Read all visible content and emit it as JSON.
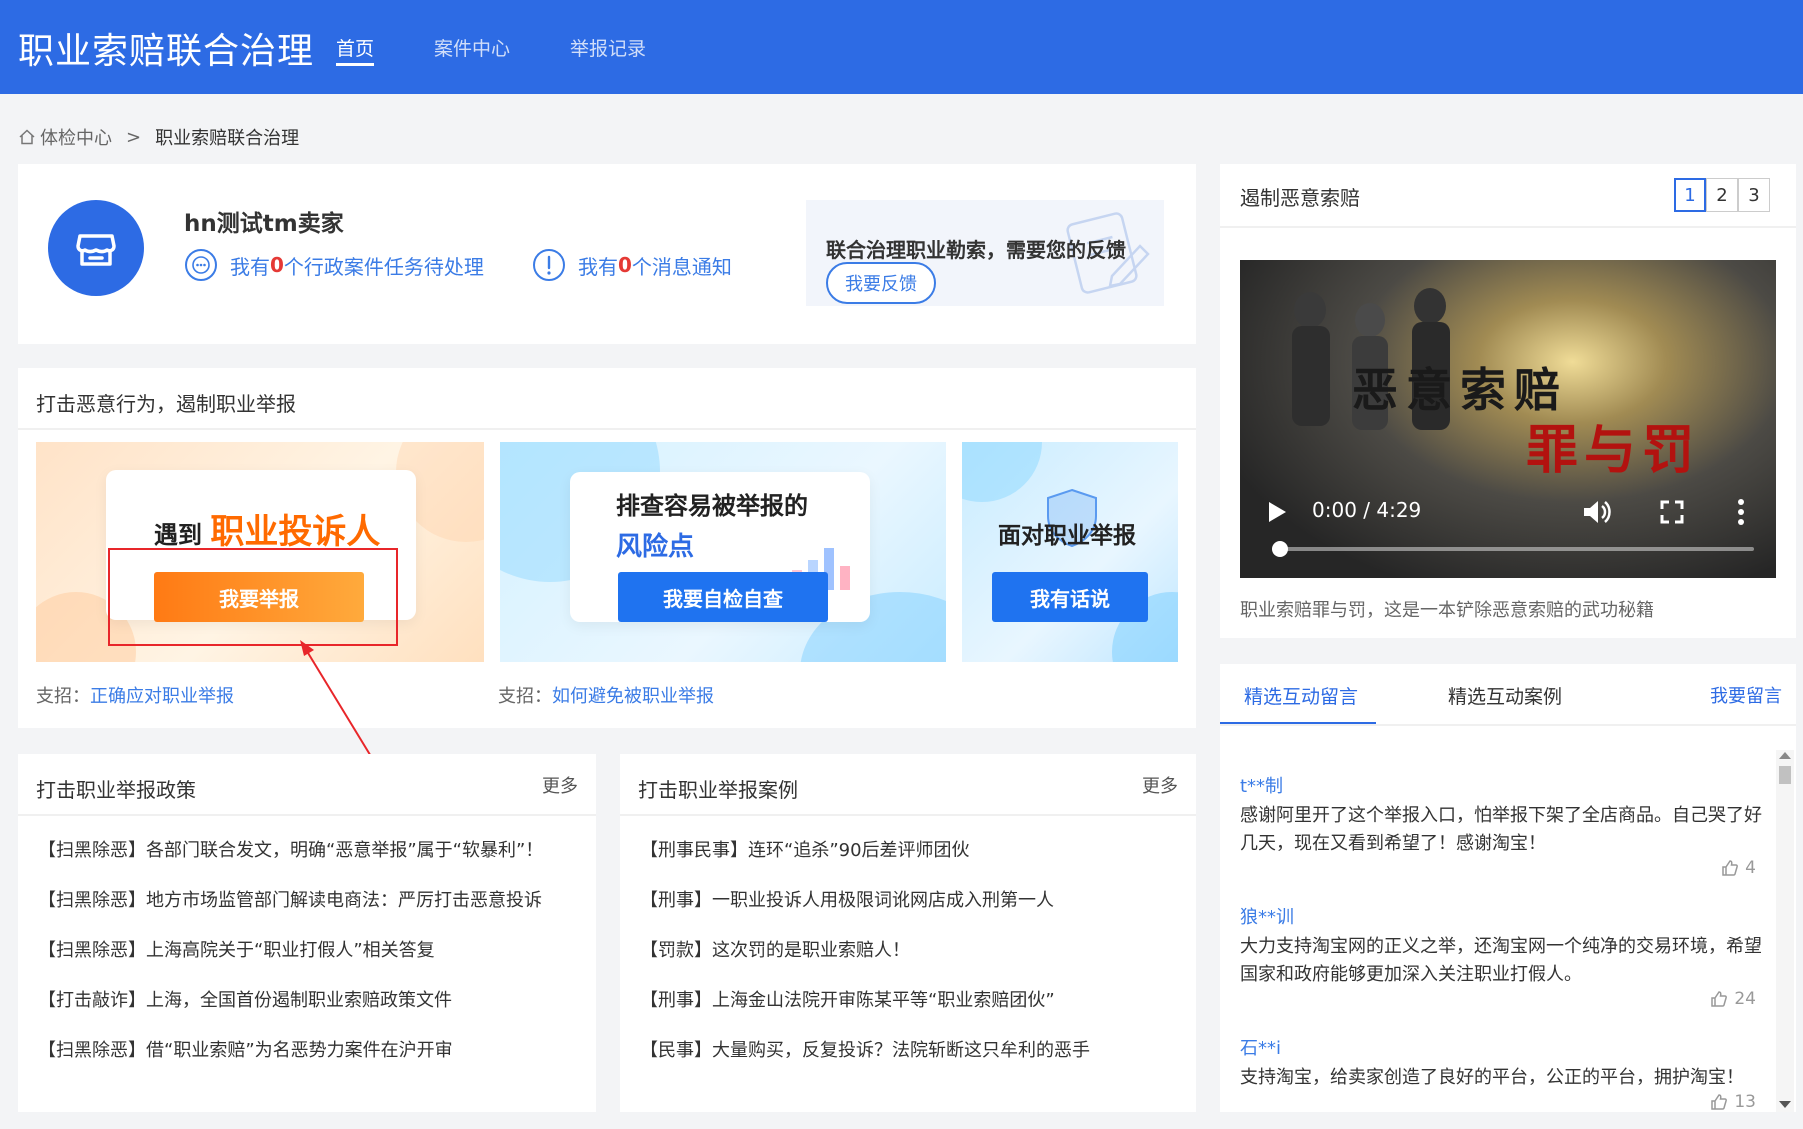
{
  "header": {
    "brand": "职业索赔联合治理",
    "nav": [
      {
        "label": "首页",
        "active": true
      },
      {
        "label": "案件中心",
        "active": false
      },
      {
        "label": "举报记录",
        "active": false
      }
    ],
    "bg_color": "#2d6be4"
  },
  "breadcrumb": {
    "home": "体检中心",
    "separator": ">",
    "current": "职业索赔联合治理",
    "home_icon": "home-icon"
  },
  "user": {
    "name": "hn测试tm卖家",
    "task_notice": {
      "prefix": "我有",
      "count": "0",
      "suffix": "个行政案件任务待处理"
    },
    "message_notice": {
      "prefix": "我有",
      "count": "0",
      "suffix": "个消息通知"
    },
    "feedback_text": "联合治理职业勒索，需要您的反馈",
    "feedback_button": "我要反馈"
  },
  "banner_section": {
    "title": "打击恶意行为，遏制职业举报",
    "banners": [
      {
        "title_prefix": "遇到",
        "title_highlight": "职业投诉人",
        "button": "我要举报"
      },
      {
        "title_line1": "排查容易被举报的",
        "title_line2": "风险点",
        "button": "我要自检自查"
      },
      {
        "title": "面对职业举报",
        "button": "我有话说"
      }
    ],
    "tips": [
      {
        "label": "支招：",
        "link": "正确应对职业举报"
      },
      {
        "label": "支招：",
        "link": "如何避免被职业举报"
      }
    ]
  },
  "policy_list": {
    "title": "打击职业举报政策",
    "more": "更多",
    "items": [
      "【扫黑除恶】各部门联合发文，明确“恶意举报”属于“软暴利”！",
      "【扫黑除恶】地方市场监管部门解读电商法：严厉打击恶意投诉",
      "【扫黑除恶】上海高院关于“职业打假人”相关答复",
      "【打击敲诈】上海，全国首份遏制职业索赔政策文件",
      "【扫黑除恶】借“职业索赔”为名恶势力案件在沪开审"
    ]
  },
  "case_list": {
    "title": "打击职业举报案例",
    "more": "更多",
    "items": [
      "【刑事民事】连环“追杀”90后差评师团伙",
      "【刑事】一职业投诉人用极限词讹网店成入刑第一人",
      "【罚款】这次罚的是职业索赔人！",
      "【刑事】上海金山法院开审陈某平等“职业索赔团伙”",
      "【民事】大量购买，反复投诉？法院斩断这只牟利的恶手"
    ]
  },
  "video_panel": {
    "title": "遏制恶意索赔",
    "pages": [
      "1",
      "2",
      "3"
    ],
    "active_page": "1",
    "video_title_1": "恶意索赔",
    "video_title_2": "罪与罚",
    "time": "0:00 / 4:29",
    "progress": 0.0,
    "caption": "职业索赔罪与罚，这是一本铲除恶意索赔的武功秘籍"
  },
  "comments": {
    "tabs": [
      "精选互动留言",
      "精选互动案例"
    ],
    "active_tab": "精选互动留言",
    "post_button": "我要留言",
    "items": [
      {
        "user": "t**制",
        "text": "感谢阿里开了这个举报入口，怕举报下架了全店商品。自己哭了好几天，现在又看到希望了！感谢淘宝！",
        "likes": "4"
      },
      {
        "user": "狼**训",
        "text": "大力支持淘宝网的正义之举，还淘宝网一个纯净的交易环境，希望国家和政府能够更加深入关注职业打假人。",
        "likes": "24"
      },
      {
        "user": "石**i",
        "text": "支持淘宝，给卖家创造了良好的平台，公正的平台，拥护淘宝！",
        "likes": "13"
      }
    ]
  },
  "colors": {
    "primary": "#2d6be4",
    "link": "#3b7ce6",
    "alert": "#e53935",
    "annotation": "#e8262a"
  }
}
